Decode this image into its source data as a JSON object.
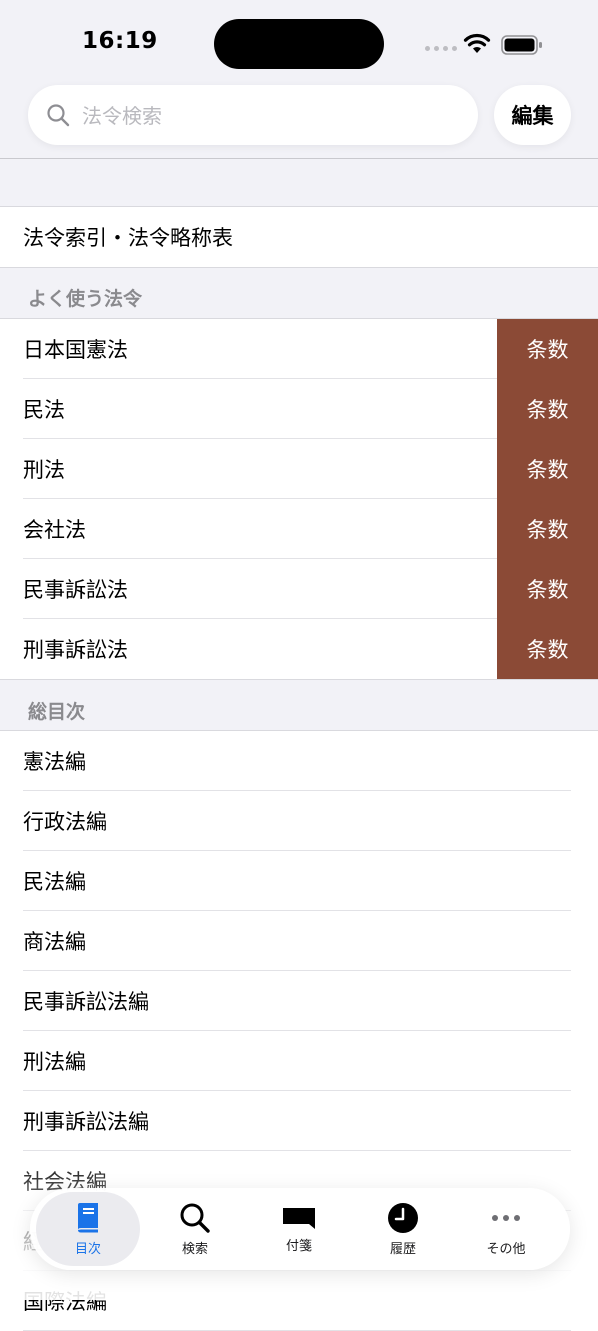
{
  "status_bar": {
    "time": "16:19"
  },
  "search": {
    "placeholder": "法令検索",
    "edit_label": "編集"
  },
  "index_item": "法令索引・法令略称表",
  "frequent": {
    "header": "よく使う法令",
    "button_label": "条数",
    "button_color": "#8b4a36",
    "items": [
      "日本国憲法",
      "民法",
      "刑法",
      "会社法",
      "民事訴訟法",
      "刑事訴訟法"
    ]
  },
  "toc": {
    "header": "総目次",
    "items": [
      "憲法編",
      "行政法編",
      "民法編",
      "商法編",
      "民事訴訟法編",
      "刑法編",
      "刑事訴訟法編",
      "社会法編",
      "経済法編",
      "国際法編"
    ]
  },
  "tabbar": {
    "tabs": [
      {
        "label": "目次",
        "icon": "book-icon"
      },
      {
        "label": "検索",
        "icon": "search-icon"
      },
      {
        "label": "付箋",
        "icon": "flag-icon"
      },
      {
        "label": "履歴",
        "icon": "clock-icon"
      },
      {
        "label": "その他",
        "icon": "more-icon"
      }
    ],
    "active_color": "#1a73e8"
  }
}
